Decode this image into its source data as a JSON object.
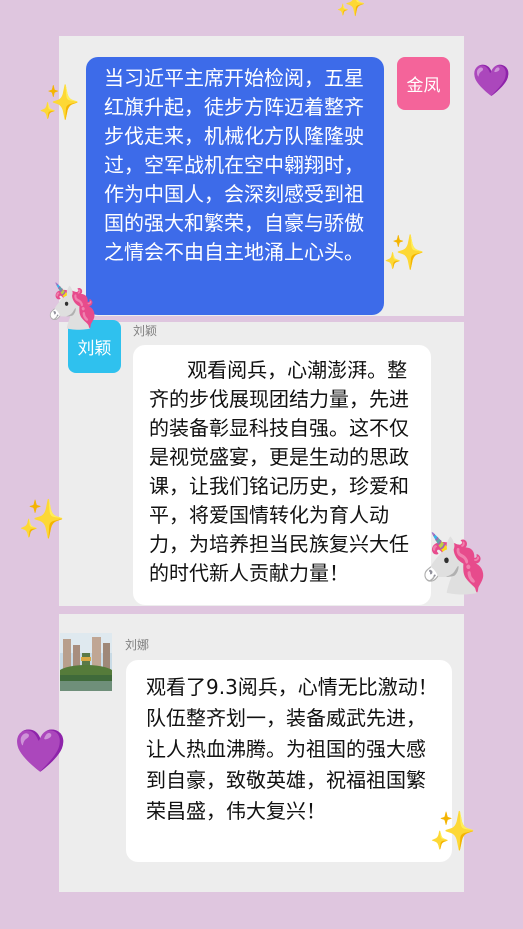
{
  "messages": [
    {
      "sender": "金凤",
      "text": "当习近平主席开始检阅，五星红旗升起，徒步方阵迈着整齐步伐走来，机械化方队隆隆驶过，空军战机在空中翱翔时，作为中国人，会深刻感受到祖国的强大和繁荣，自豪与骄傲之情会不由自主地涌上心头。"
    },
    {
      "sender": "刘颖",
      "avatar_text": "刘颖",
      "text": "      观看阅兵，心潮澎湃。整齐的步伐展现团结力量，先进的装备彰显科技自强。这不仅是视觉盛宴，更是生动的思政课，让我们铭记历史，珍爱和平，将爱国情转化为育人动力，为培养担当民族复兴大任的时代新人贡献力量！"
    },
    {
      "sender": "刘娜",
      "text": "观看了9.3阅兵，心情无比激动！队伍整齐划一，装备威武先进，让人热血沸腾。为祖国的强大感到自豪，致敬英雄，祝福祖国繁荣昌盛，伟大复兴！"
    }
  ],
  "decorations": {
    "sparkle": "✨",
    "heart": "💜",
    "unicorn": "🦄"
  },
  "colors": {
    "background": "#dfc6df",
    "card": "#ededed",
    "bubble_blue": "#3d6be9",
    "avatar_pink": "#f4649a",
    "avatar_cyan": "#2fc1ee"
  }
}
